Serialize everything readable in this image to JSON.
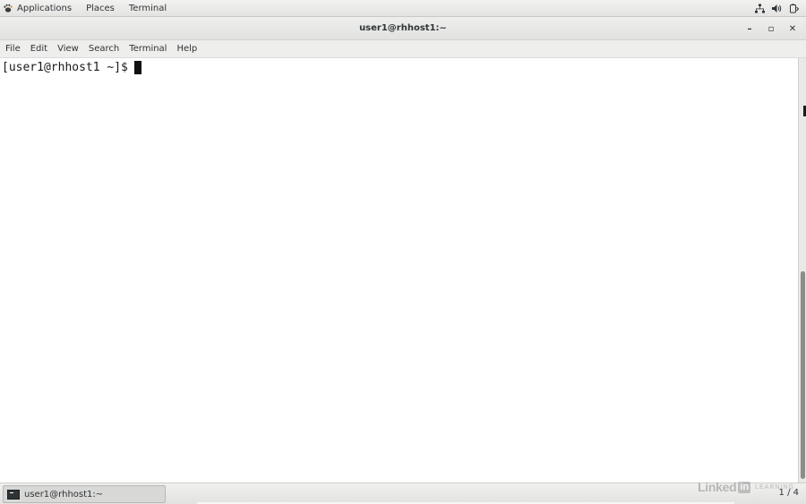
{
  "topbar": {
    "menus": [
      {
        "label": "Applications",
        "icon": "gnome-foot-icon"
      },
      {
        "label": "Places"
      },
      {
        "label": "Terminal"
      }
    ],
    "tray_icons": [
      "network-icon",
      "volume-icon",
      "power-icon"
    ]
  },
  "window": {
    "title": "user1@rhhost1:~",
    "controls": {
      "minimize": "–",
      "maximize": "▫",
      "close": "✕"
    }
  },
  "menubar": {
    "items": [
      "File",
      "Edit",
      "View",
      "Search",
      "Terminal",
      "Help"
    ]
  },
  "terminal": {
    "prompt": "[user1@rhhost1 ~]$",
    "input": ""
  },
  "taskbar": {
    "task_label": "user1@rhhost1:~",
    "workspace": "1 / 4"
  },
  "watermark": {
    "linked": "Linked",
    "in": "in",
    "learning": "LEARNING"
  },
  "colors": {
    "panel_bg": "#eeeeec",
    "terminal_bg": "#ffffff",
    "terminal_fg": "#1a1a1a",
    "scroll_thumb": "#8a8d88"
  }
}
